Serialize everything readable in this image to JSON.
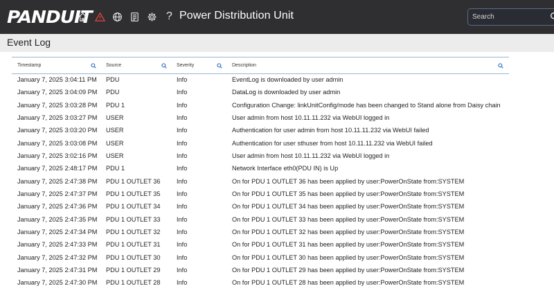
{
  "header": {
    "logo": "PANDUIT",
    "title": "Power Distribution Unit",
    "search_placeholder": "Search",
    "nav_icons": [
      "home-icon",
      "alarm-icon",
      "globe-icon",
      "document-icon",
      "gear-icon",
      "help-icon"
    ],
    "nav_help_glyph": "?"
  },
  "page": {
    "title": "Event Log"
  },
  "table": {
    "columns": [
      "Timestamp",
      "Source",
      "Severity",
      "Description"
    ],
    "rows": [
      {
        "ts": "January 7, 2025 3:04:11 PM",
        "src": "PDU",
        "sev": "Info",
        "desc": "EventLog is downloaded by user admin"
      },
      {
        "ts": "January 7, 2025 3:04:09 PM",
        "src": "PDU",
        "sev": "Info",
        "desc": "DataLog is downloaded by user admin"
      },
      {
        "ts": "January 7, 2025 3:03:28 PM",
        "src": "PDU 1",
        "sev": "Info",
        "desc": "Configuration Change: linkUnitConfig/mode has been changed to Stand alone from Daisy chain"
      },
      {
        "ts": "January 7, 2025 3:03:27 PM",
        "src": "USER",
        "sev": "Info",
        "desc": "User admin from host 10.11.11.232 via WebUI logged in"
      },
      {
        "ts": "January 7, 2025 3:03:20 PM",
        "src": "USER",
        "sev": "Info",
        "desc": "Authentication for user admin from host 10.11.11.232 via WebUI failed"
      },
      {
        "ts": "January 7, 2025 3:03:08 PM",
        "src": "USER",
        "sev": "Info",
        "desc": "Authentication for user sthuser from host 10.11.11.232 via WebUI failed"
      },
      {
        "ts": "January 7, 2025 3:02:16 PM",
        "src": "USER",
        "sev": "Info",
        "desc": "User admin from host 10.11.11.232 via WebUI logged in"
      },
      {
        "ts": "January 7, 2025 2:48:17 PM",
        "src": "PDU 1",
        "sev": "Info",
        "desc": "Network Interface eth0(PDU IN) is Up"
      },
      {
        "ts": "January 7, 2025 2:47:38 PM",
        "src": "PDU 1 OUTLET 36",
        "sev": "Info",
        "desc": "On for PDU 1 OUTLET 36 has been applied by user:PowerOnState from:SYSTEM"
      },
      {
        "ts": "January 7, 2025 2:47:37 PM",
        "src": "PDU 1 OUTLET 35",
        "sev": "Info",
        "desc": "On for PDU 1 OUTLET 35 has been applied by user:PowerOnState from:SYSTEM"
      },
      {
        "ts": "January 7, 2025 2:47:36 PM",
        "src": "PDU 1 OUTLET 34",
        "sev": "Info",
        "desc": "On for PDU 1 OUTLET 34 has been applied by user:PowerOnState from:SYSTEM"
      },
      {
        "ts": "January 7, 2025 2:47:35 PM",
        "src": "PDU 1 OUTLET 33",
        "sev": "Info",
        "desc": "On for PDU 1 OUTLET 33 has been applied by user:PowerOnState from:SYSTEM"
      },
      {
        "ts": "January 7, 2025 2:47:34 PM",
        "src": "PDU 1 OUTLET 32",
        "sev": "Info",
        "desc": "On for PDU 1 OUTLET 32 has been applied by user:PowerOnState from:SYSTEM"
      },
      {
        "ts": "January 7, 2025 2:47:33 PM",
        "src": "PDU 1 OUTLET 31",
        "sev": "Info",
        "desc": "On for PDU 1 OUTLET 31 has been applied by user:PowerOnState from:SYSTEM"
      },
      {
        "ts": "January 7, 2025 2:47:32 PM",
        "src": "PDU 1 OUTLET 30",
        "sev": "Info",
        "desc": "On for PDU 1 OUTLET 30 has been applied by user:PowerOnState from:SYSTEM"
      },
      {
        "ts": "January 7, 2025 2:47:31 PM",
        "src": "PDU 1 OUTLET 29",
        "sev": "Info",
        "desc": "On for PDU 1 OUTLET 29 has been applied by user:PowerOnState from:SYSTEM"
      },
      {
        "ts": "January 7, 2025 2:47:30 PM",
        "src": "PDU 1 OUTLET 28",
        "sev": "Info",
        "desc": "On for PDU 1 OUTLET 28 has been applied by user:PowerOnState from:SYSTEM"
      }
    ]
  },
  "colors": {
    "topbar": "#2f2f31",
    "alarm_icon": "#e0433b",
    "column_search_icon": "#3a78c2",
    "header_rule": "#9bb7cf",
    "page_band": "#ececec"
  }
}
